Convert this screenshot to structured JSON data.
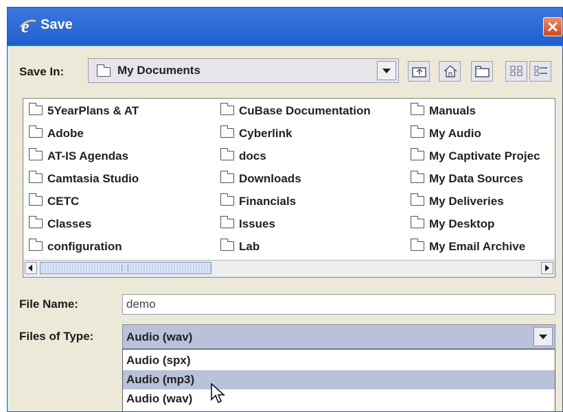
{
  "window": {
    "title": "Save",
    "close_icon": "close-icon"
  },
  "save_in": {
    "label": "Save In:",
    "value": "My Documents"
  },
  "toolbar": {
    "icons": [
      "up-folder-icon",
      "home-icon",
      "new-folder-icon",
      "list-view-icon",
      "details-view-icon"
    ]
  },
  "files": [
    "5YearPlans & AT",
    "Adobe",
    "AT-IS Agendas",
    "Camtasia Studio",
    "CETC",
    "Classes",
    "configuration",
    "CuBase Documentation",
    "Cyberlink",
    "docs",
    "Downloads",
    "Financials",
    "Issues",
    "Lab",
    "Manuals",
    "My Audio",
    "My Captivate Projec",
    "My Data Sources",
    "My Deliveries",
    "My Desktop",
    "My Email Archive"
  ],
  "file_name": {
    "label": "File Name:",
    "value": "demo"
  },
  "file_type": {
    "label": "Files of Type:",
    "value": "Audio (wav)",
    "options": [
      "Audio (spx)",
      "Audio (mp3)",
      "Audio (wav)"
    ],
    "highlighted": "Audio (mp3)"
  },
  "colors": {
    "titlebar": "#1f5fd0",
    "window_bg": "#ece9d8",
    "selection": "#b8c2d8"
  }
}
